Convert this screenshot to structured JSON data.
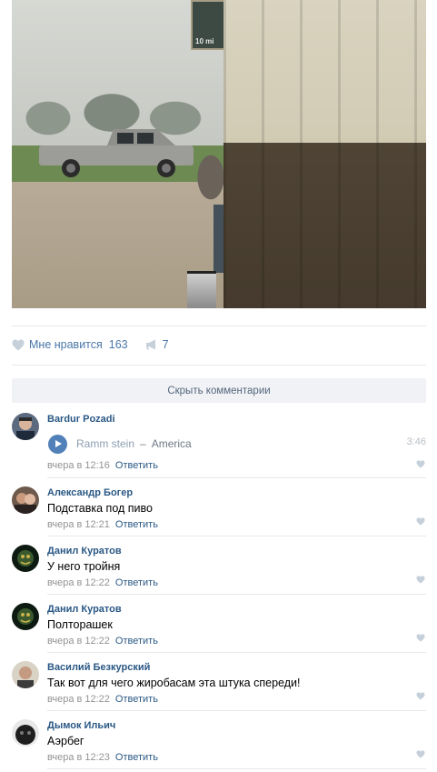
{
  "photo": {
    "sign_text": "10 mi"
  },
  "post_actions": {
    "like_label": "Мне нравится",
    "like_count": "163",
    "share_count": "7",
    "heart_color": "#c5d0db",
    "link_color": "#4a76a8"
  },
  "hide_comments_label": "Скрыть комментарии",
  "reply_label": "Ответить",
  "comments": [
    {
      "author": "Bardur Pozadi",
      "audio": {
        "artist": "Ramm stein",
        "dash": "–",
        "title": "America",
        "duration": "3:46"
      },
      "time": "вчера в 12:16"
    },
    {
      "author": "Александр Богер",
      "text": "Подставка под пиво",
      "time": "вчера в 12:21"
    },
    {
      "author": "Данил Куратов",
      "text": "У него тройня",
      "time": "вчера в 12:22"
    },
    {
      "author": "Данил Куратов",
      "text": "Полторашек",
      "time": "вчера в 12:22"
    },
    {
      "author": "Василий Безкурский",
      "text": "Так вот для чего жиробасам эта штука спереди!",
      "time": "вчера в 12:22"
    },
    {
      "author": "Дымок Ильич",
      "text": "Аэрбег",
      "time": "вчера в 12:23"
    }
  ]
}
